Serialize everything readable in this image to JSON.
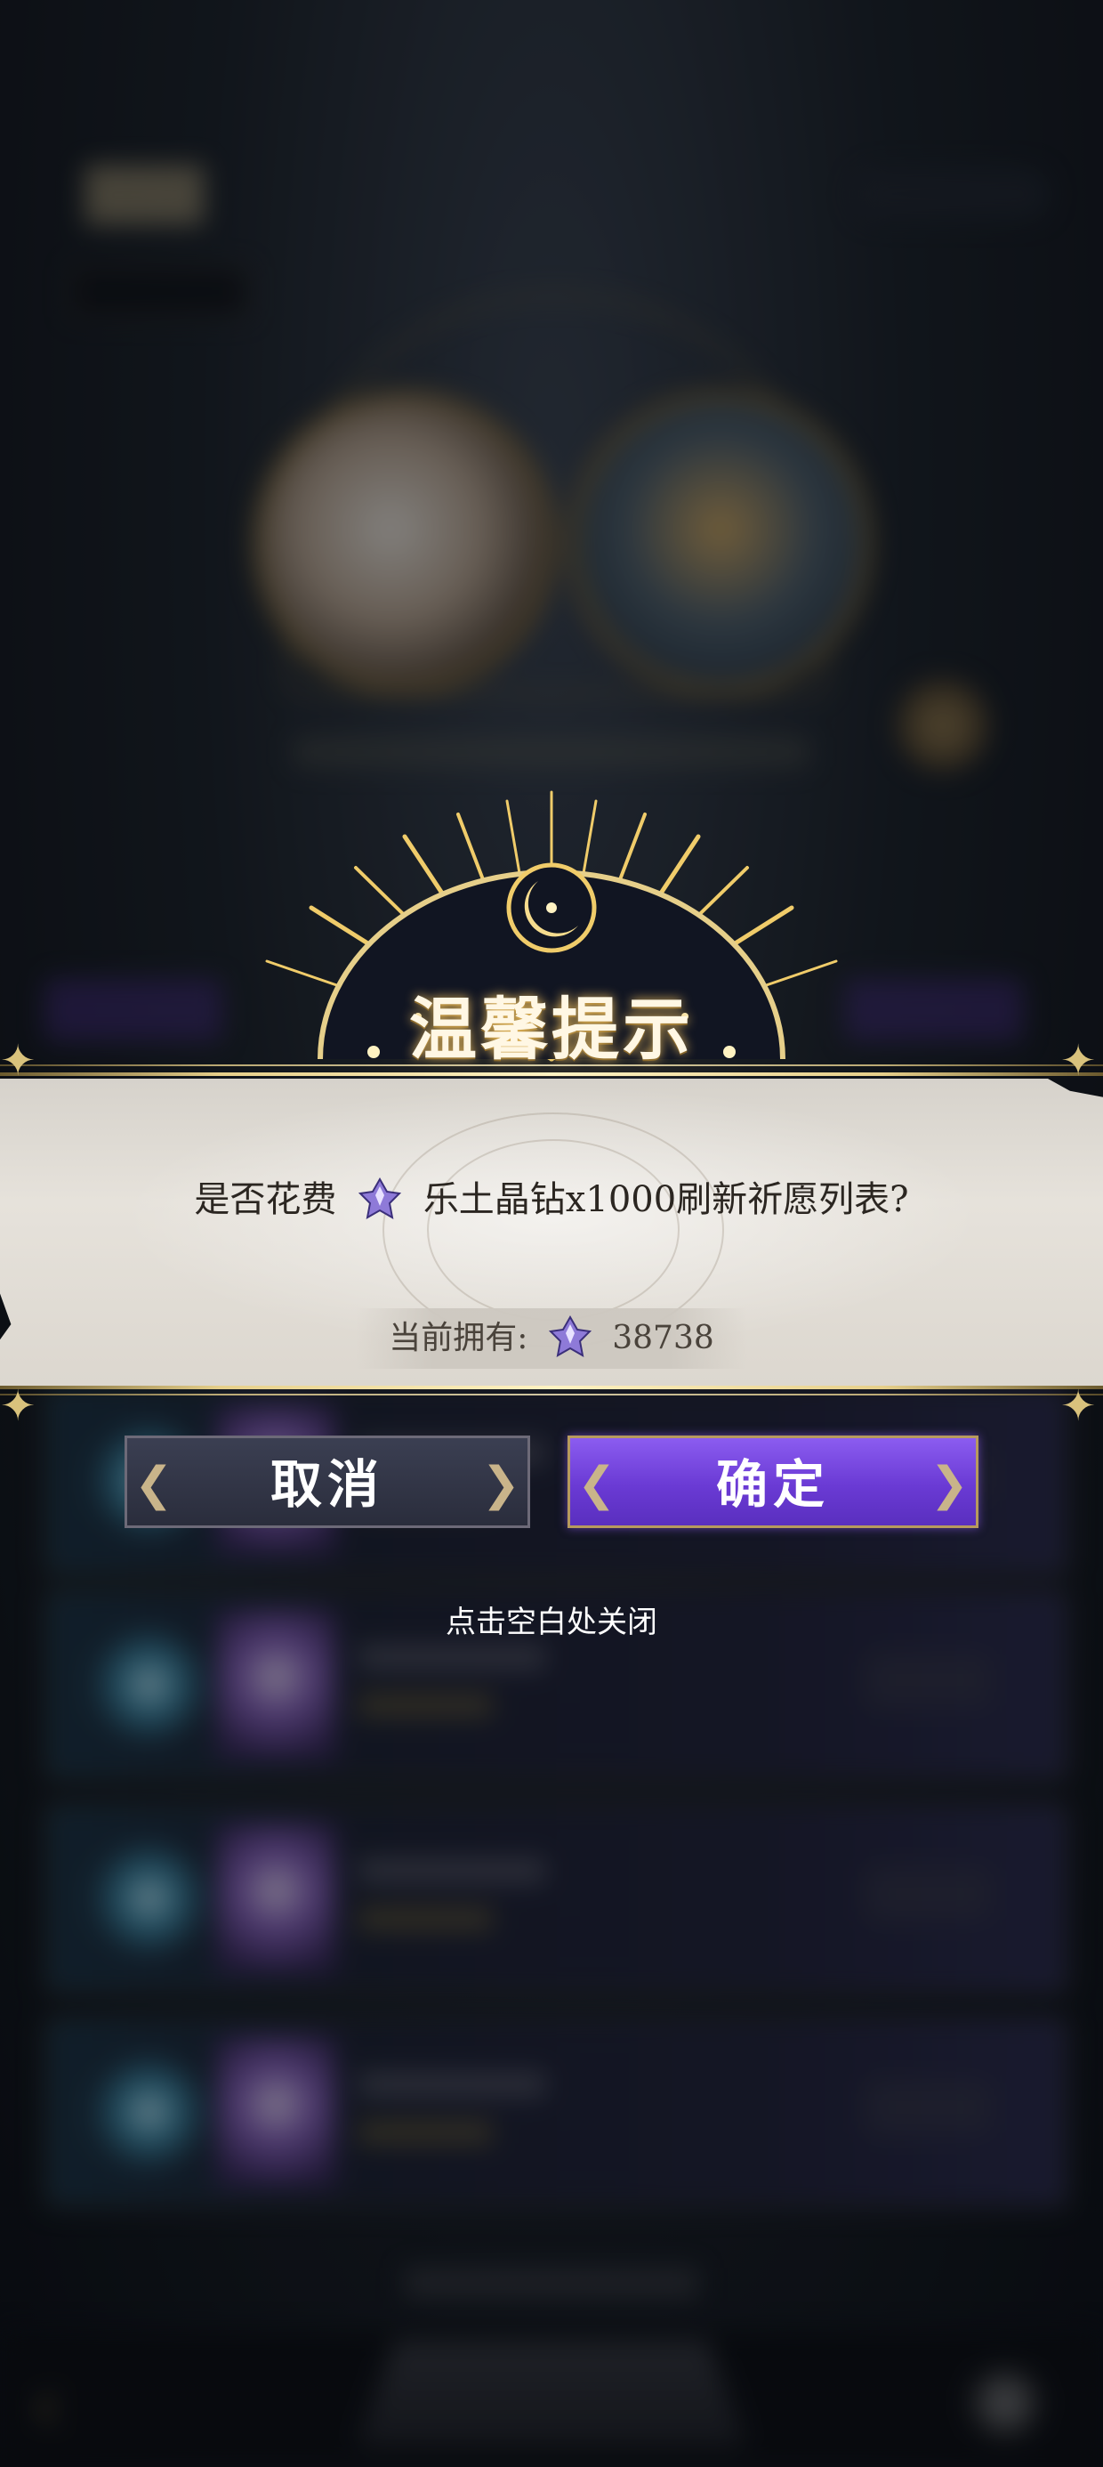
{
  "dialog": {
    "title": "温馨提示",
    "message_before": "是否花费",
    "message_after": "乐土晶钻x1000刷新祈愿列表?",
    "currency_icon": "crystal-diamond-icon",
    "owned_label": "当前拥有:",
    "owned_amount": "38738",
    "cancel_label": "取消",
    "confirm_label": "确定",
    "close_hint": "点击空白处关闭"
  },
  "colors": {
    "confirm_button": "#6a3ad4",
    "cancel_button": "#2f3242",
    "gold_accent": "#e6cf8a",
    "panel": "#e2ded7"
  }
}
